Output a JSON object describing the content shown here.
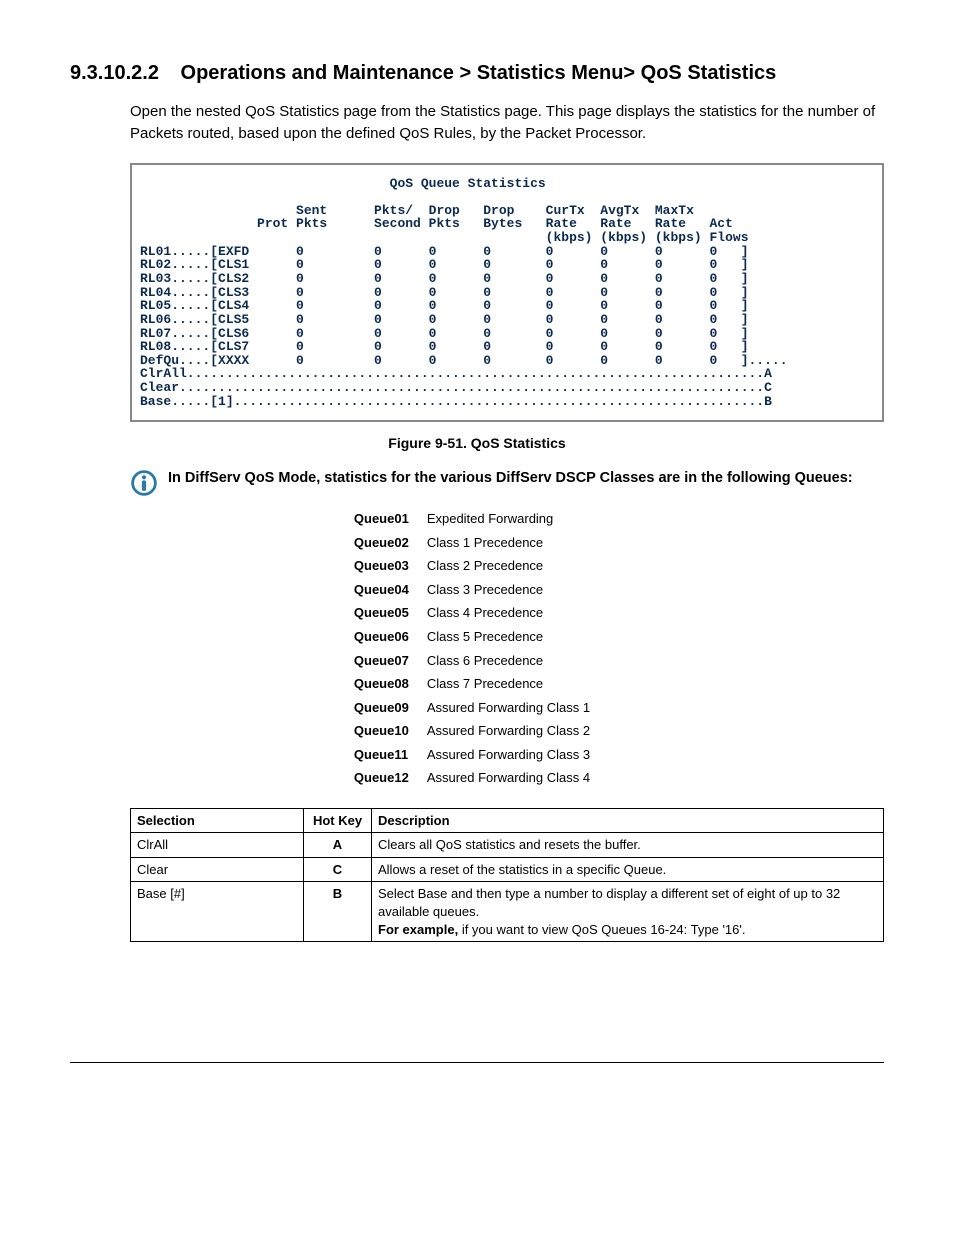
{
  "heading": {
    "number": "9.3.10.2.2",
    "title": "Operations and Maintenance > Statistics Menu> QoS Statistics"
  },
  "intro": "Open the nested QoS Statistics page from the Statistics page. This page displays the statistics for the number of Packets routed, based upon the defined QoS Rules, by the Packet Processor.",
  "console": {
    "title": "QoS Queue Statistics",
    "headers": {
      "prot": "Prot",
      "sentpkts": "Sent\nPkts",
      "pktspersec": "Pkts/\nSecond",
      "droppkts": "Drop\nPkts",
      "dropbytes": "Drop\nBytes",
      "curtx": "CurTx\nRate\n(kbps)",
      "avgtx": "AvgTx\nRate\n(kbps)",
      "maxtx": "MaxTx\nRate\n(kbps)",
      "actflows": "Act\nFlows"
    },
    "rows": [
      {
        "label": "RL01.....[EXFD",
        "sent": "0",
        "pps": "0",
        "dpkts": "0",
        "dbytes": "0",
        "cur": "0",
        "avg": "0",
        "max": "0",
        "act": "0",
        "eol": "]"
      },
      {
        "label": "RL02.....[CLS1",
        "sent": "0",
        "pps": "0",
        "dpkts": "0",
        "dbytes": "0",
        "cur": "0",
        "avg": "0",
        "max": "0",
        "act": "0",
        "eol": "]"
      },
      {
        "label": "RL03.....[CLS2",
        "sent": "0",
        "pps": "0",
        "dpkts": "0",
        "dbytes": "0",
        "cur": "0",
        "avg": "0",
        "max": "0",
        "act": "0",
        "eol": "]"
      },
      {
        "label": "RL04.....[CLS3",
        "sent": "0",
        "pps": "0",
        "dpkts": "0",
        "dbytes": "0",
        "cur": "0",
        "avg": "0",
        "max": "0",
        "act": "0",
        "eol": "]"
      },
      {
        "label": "RL05.....[CLS4",
        "sent": "0",
        "pps": "0",
        "dpkts": "0",
        "dbytes": "0",
        "cur": "0",
        "avg": "0",
        "max": "0",
        "act": "0",
        "eol": "]"
      },
      {
        "label": "RL06.....[CLS5",
        "sent": "0",
        "pps": "0",
        "dpkts": "0",
        "dbytes": "0",
        "cur": "0",
        "avg": "0",
        "max": "0",
        "act": "0",
        "eol": "]"
      },
      {
        "label": "RL07.....[CLS6",
        "sent": "0",
        "pps": "0",
        "dpkts": "0",
        "dbytes": "0",
        "cur": "0",
        "avg": "0",
        "max": "0",
        "act": "0",
        "eol": "]"
      },
      {
        "label": "RL08.....[CLS7",
        "sent": "0",
        "pps": "0",
        "dpkts": "0",
        "dbytes": "0",
        "cur": "0",
        "avg": "0",
        "max": "0",
        "act": "0",
        "eol": "]"
      },
      {
        "label": "DefQu....[XXXX",
        "sent": "0",
        "pps": "0",
        "dpkts": "0",
        "dbytes": "0",
        "cur": "0",
        "avg": "0",
        "max": "0",
        "act": "0",
        "eol": "]....."
      }
    ],
    "footer": {
      "clrall": "ClrAll..........................................................................A",
      "clear": "Clear...........................................................................C",
      "base": "Base.....[1]....................................................................B"
    }
  },
  "figureCaption": "Figure 9-51. QoS Statistics",
  "noteText": "In DiffServ QoS Mode, statistics for the various DiffServ DSCP Classes are in the following Queues:",
  "queues": [
    {
      "name": "Queue01",
      "desc": "Expedited Forwarding"
    },
    {
      "name": "Queue02",
      "desc": "Class 1 Precedence"
    },
    {
      "name": "Queue03",
      "desc": "Class 2 Precedence"
    },
    {
      "name": "Queue04",
      "desc": "Class 3 Precedence"
    },
    {
      "name": "Queue05",
      "desc": "Class 4 Precedence"
    },
    {
      "name": "Queue06",
      "desc": "Class 5 Precedence"
    },
    {
      "name": "Queue07",
      "desc": "Class 6 Precedence"
    },
    {
      "name": "Queue08",
      "desc": "Class 7 Precedence"
    },
    {
      "name": "Queue09",
      "desc": "Assured Forwarding Class 1"
    },
    {
      "name": "Queue10",
      "desc": "Assured Forwarding Class 2"
    },
    {
      "name": "Queue11",
      "desc": "Assured Forwarding Class 3"
    },
    {
      "name": "Queue12",
      "desc": "Assured Forwarding Class 4"
    }
  ],
  "selTable": {
    "headers": {
      "sel": "Selection",
      "hot": "Hot Key",
      "desc": "Description"
    },
    "rows": [
      {
        "sel": "ClrAll",
        "hot": "A",
        "desc": "Clears all QoS statistics and resets the buffer."
      },
      {
        "sel": "Clear",
        "hot": "C",
        "desc": "Allows a reset of the statistics in a specific Queue."
      },
      {
        "sel": "Base [#]",
        "hot": "B",
        "desc1": "Select Base and then type a number to display a different set of eight of up to 32 available queues.",
        "descBoldLead": "For example,",
        "desc2": " if you want to view QoS Queues 16-24: Type '16'."
      }
    ]
  }
}
